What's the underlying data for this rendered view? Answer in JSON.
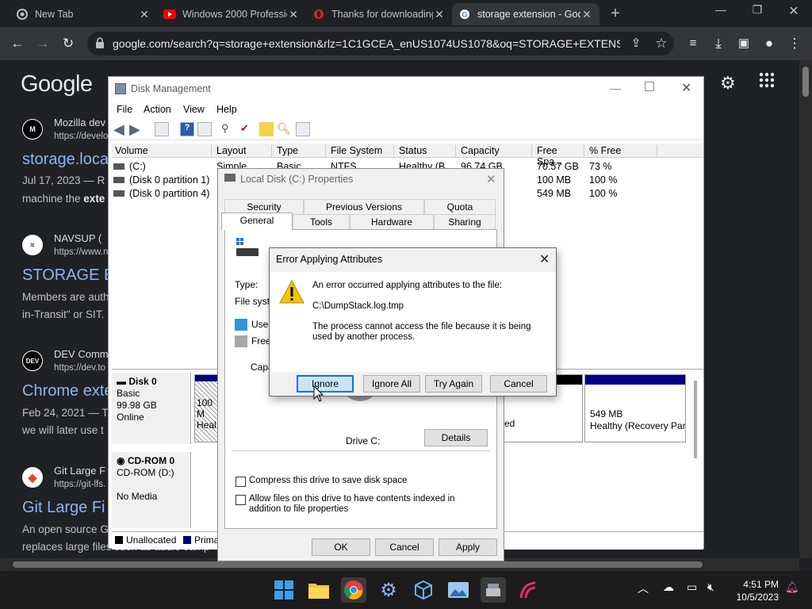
{
  "browser": {
    "tabs": [
      {
        "title": "New Tab",
        "icon": "chrome-icon"
      },
      {
        "title": "Windows 2000 Professional",
        "icon": "youtube-icon"
      },
      {
        "title": "Thanks for downloading",
        "icon": "opera-icon"
      },
      {
        "title": "storage extension - Goo",
        "icon": "google-icon"
      }
    ],
    "url": "google.com/search?q=storage+extension&rlz=1C1GCEA_enUS1074US1078&oq=STORAGE+EXTENSI..."
  },
  "google": {
    "logo": "Google",
    "results": [
      {
        "site": "Mozilla dev",
        "url": "https://develo",
        "title": "storage.loca",
        "snippet1": "Jul 17, 2023 — R",
        "snippet2_pre": "machine the ",
        "snippet2_bold": "exte",
        "icon_text": "M"
      },
      {
        "site": "NAVSUP (",
        "url": "https://www.n",
        "title": "STORAGE E",
        "snippet1": "Members are auth",
        "snippet2_pre": "in-Transit\" or SIT.",
        "snippet2_bold": "",
        "icon_text": "≈"
      },
      {
        "site": "DEV Comm",
        "url": "https://dev.to",
        "title": "Chrome exte",
        "snippet1": "Feb 24, 2021 — T",
        "snippet2_pre": "we will later use t",
        "snippet2_bold": "",
        "icon_text": "DEV"
      },
      {
        "site": "Git Large F",
        "url": "https://git-lfs.",
        "title": "Git Large Fi",
        "snippet1": "An open source G",
        "snippet2_pre": "replaces large files such as audio samp",
        "snippet2_bold": "",
        "icon_text": "◆"
      }
    ]
  },
  "disk_management": {
    "title": "Disk Management",
    "menu": [
      "File",
      "Action",
      "View",
      "Help"
    ],
    "columns": [
      "Volume",
      "Layout",
      "Type",
      "File System",
      "Status",
      "Capacity",
      "Free Spa...",
      "% Free"
    ],
    "volumes": [
      {
        "volume": "(C:)",
        "layout": "Simple",
        "type": "Basic",
        "fs": "NTFS",
        "status": "Healthy (B...",
        "capacity": "96.74 GB",
        "free": "70.57 GB",
        "pct": "73 %"
      },
      {
        "volume": "(Disk 0 partition 1)",
        "layout": "",
        "type": "",
        "fs": "",
        "status": "",
        "capacity": "",
        "free": "100 MB",
        "pct": "100 %"
      },
      {
        "volume": "(Disk 0 partition 4)",
        "layout": "",
        "type": "",
        "fs": "",
        "status": "",
        "capacity": "",
        "free": "549 MB",
        "pct": "100 %"
      }
    ],
    "disk0": {
      "name": "Disk 0",
      "type": "Basic",
      "size": "99.98 GB",
      "state": "Online"
    },
    "part1": {
      "size": "100 M",
      "status": "Heal"
    },
    "part3_status": "ed",
    "part4": {
      "size": "549 MB",
      "status": "Healthy (Recovery Par"
    },
    "cdrom": {
      "name": "CD-ROM 0",
      "drive": "CD-ROM (D:)",
      "media": "No Media"
    },
    "legend": {
      "unallocated": "Unallocated",
      "primary": "Prima"
    }
  },
  "properties": {
    "title": "Local Disk (C:) Properties",
    "tabs_row1": [
      "Security",
      "Previous Versions",
      "Quota"
    ],
    "tabs_row2": [
      "General",
      "Tools",
      "Hardware",
      "Sharing"
    ],
    "type_label": "Type:",
    "fs_label": "File syster",
    "used_label": "Used",
    "free_label": "Free",
    "capacity_label": "Capa",
    "drive_label": "Drive C:",
    "details_button": "Details",
    "compress_label": "Compress this drive to save disk space",
    "index_label": "Allow files on this drive to have contents indexed in addition to file properties",
    "ok": "OK",
    "cancel": "Cancel",
    "apply": "Apply"
  },
  "error_dialog": {
    "title": "Error Applying Attributes",
    "message": "An error occurred applying attributes to the file:",
    "file": "C:\\DumpStack.log.tmp",
    "reason": "The process cannot access the file because it is being used by another process.",
    "buttons": {
      "ignore": "Ignore",
      "ignore_all": "Ignore All",
      "try_again": "Try Again",
      "cancel": "Cancel"
    }
  },
  "taskbar": {
    "time": "4:51 PM",
    "date": "10/5/2023"
  },
  "colors": {
    "primary_partition": "#000080",
    "used_space": "#2f96dc",
    "free_space": "#a8a8a8"
  }
}
